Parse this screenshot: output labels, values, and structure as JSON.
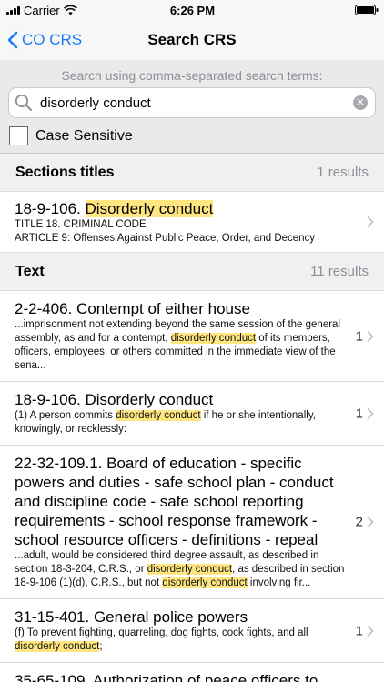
{
  "status": {
    "carrier": "Carrier",
    "time": "6:26 PM"
  },
  "nav": {
    "back_label": "CO CRS",
    "title": "Search CRS"
  },
  "search": {
    "hint": "Search using comma-separated search terms:",
    "value": "disorderly conduct",
    "case_label": "Case Sensitive"
  },
  "sections_header": {
    "title": "Sections titles",
    "count": "1 results"
  },
  "section_results": [
    {
      "number": "18-9-106.",
      "name": "Disorderly conduct",
      "line1": "TITLE 18. CRIMINAL CODE",
      "line2": "ARTICLE 9: Offenses Against Public Peace, Order, and Decency"
    }
  ],
  "text_header": {
    "title": "Text",
    "count": "11 results"
  },
  "text_results": [
    {
      "title": "2-2-406. Contempt of either house",
      "parts": [
        "...imprisonment not extending beyond the same session of the general assembly, as and for a contempt, ",
        "disorderly conduct",
        " of its members, officers, employees, or others committed in the immediate view of the sena..."
      ],
      "count": "1"
    },
    {
      "title": "18-9-106. Disorderly conduct",
      "parts": [
        "(1) A person commits ",
        "disorderly conduct",
        " if he or she intentionally, knowingly, or recklessly:"
      ],
      "count": "1"
    },
    {
      "title": "22-32-109.1. Board of education - specific powers and duties - safe school plan - conduct and discipline code - safe school reporting requirements - school response framework - school resource officers - definitions - repeal",
      "parts": [
        "...adult, would be considered third degree assault, as described in section 18-3-204, C.R.S., or ",
        "disorderly conduct",
        ", as described in section 18-9-106 (1)(d), C.R.S., but not ",
        "disorderly conduct",
        " involving fir..."
      ],
      "count": "2"
    },
    {
      "title": "31-15-401. General police powers",
      "parts": [
        "(f) To prevent fighting, quarreling, dog fights, cock fights, and all ",
        "disorderly conduct",
        ";"
      ],
      "count": "1"
    },
    {
      "title": "35-65-109. Authorization of peace officers to",
      "parts": [],
      "count": ""
    }
  ]
}
